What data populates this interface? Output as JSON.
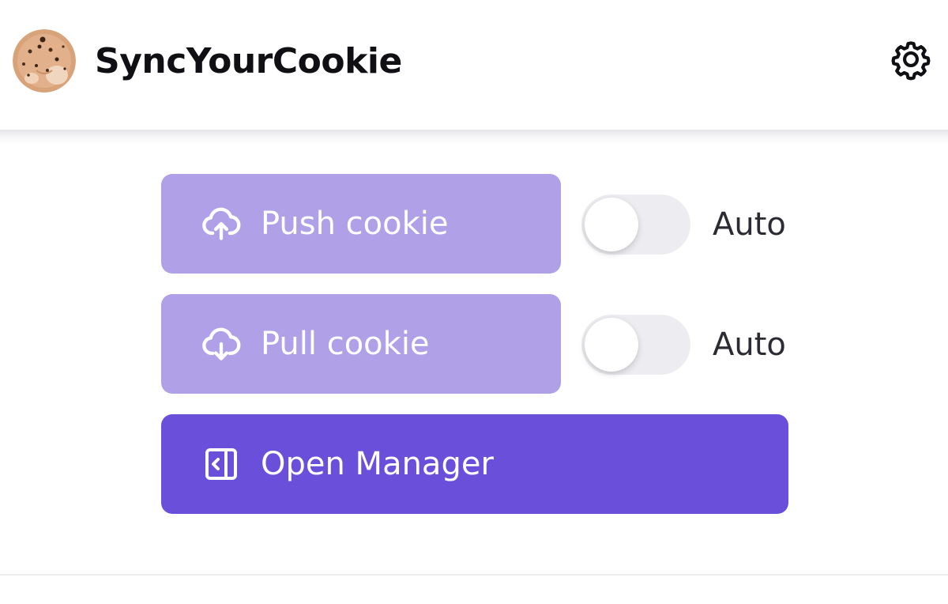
{
  "header": {
    "title": "SyncYourCookie",
    "logo_icon": "cookie-logo",
    "settings_icon": "gear-icon"
  },
  "actions": {
    "push": {
      "label": "Push cookie",
      "icon": "cloud-upload-icon",
      "auto_label": "Auto",
      "auto_enabled": false
    },
    "pull": {
      "label": "Pull cookie",
      "icon": "cloud-download-icon",
      "auto_label": "Auto",
      "auto_enabled": false
    },
    "manager": {
      "label": "Open Manager",
      "icon": "sidebar-panel-icon"
    }
  },
  "colors": {
    "primary": "#6a4fdb",
    "primary_light": "#afa0e8",
    "toggle_off": "#ededf1",
    "text_dark": "#0f0f14",
    "text_muted": "#2b2b33"
  }
}
